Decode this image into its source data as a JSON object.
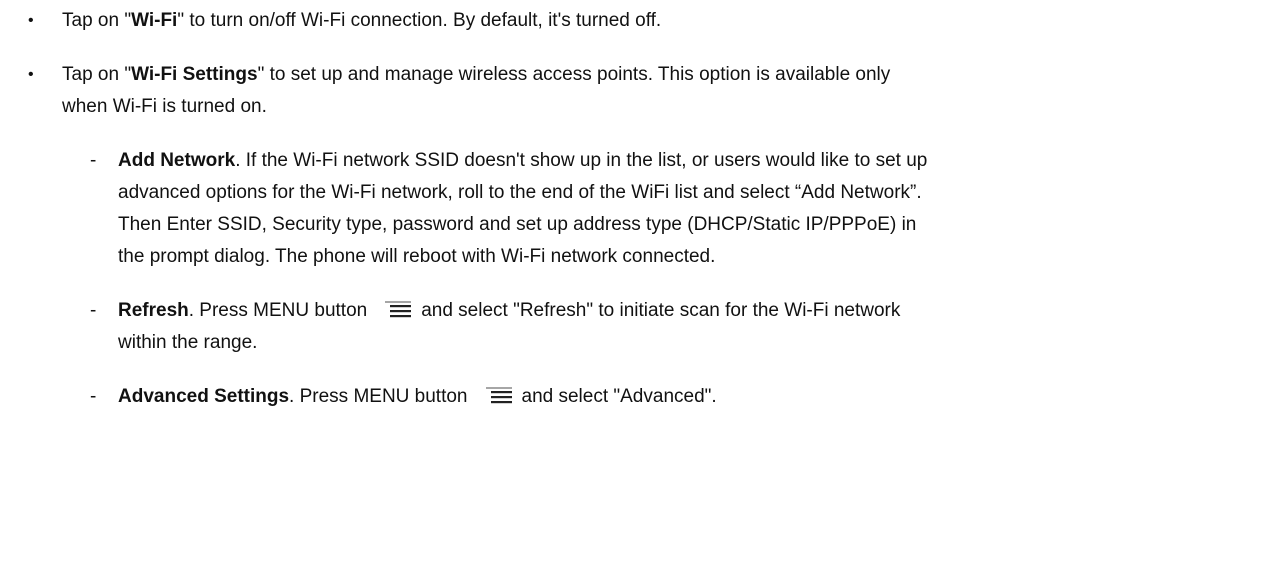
{
  "bullet_1": {
    "before": "Tap on \"",
    "bold": "Wi-Fi",
    "after": "\" to turn on/off Wi-Fi connection. By default, it's turned off."
  },
  "bullet_2": {
    "before": "Tap on \"",
    "bold": "Wi-Fi Settings",
    "after": "\" to set up and manage wireless access points. This option is available only",
    "line_2": "when Wi-Fi is turned on."
  },
  "add_network": {
    "bold": "Add Network",
    "line_1_rest": ". If the Wi-Fi network SSID doesn't show up in the list, or users would like to set up",
    "line_2": "advanced options for the Wi-Fi network, roll to the end of the WiFi list and select “Add Network”.",
    "line_3": "Then Enter SSID, Security type, password and set up address type (DHCP/Static IP/PPPoE) in",
    "line_4": "the prompt dialog. The phone will reboot with Wi-Fi network connected."
  },
  "refresh": {
    "bold": "Refresh",
    "before_icon": ". Press MENU button",
    "after_icon": "and select \"Refresh\" to initiate scan for the Wi-Fi network",
    "line_2": "within the range."
  },
  "advanced": {
    "bold": "Advanced Settings",
    "before_icon": ". Press MENU button",
    "after_icon": "and select \"Advanced\"."
  },
  "symbols": {
    "bullet": "•",
    "dash": "-"
  },
  "icons": {
    "menu": "menu-icon"
  }
}
